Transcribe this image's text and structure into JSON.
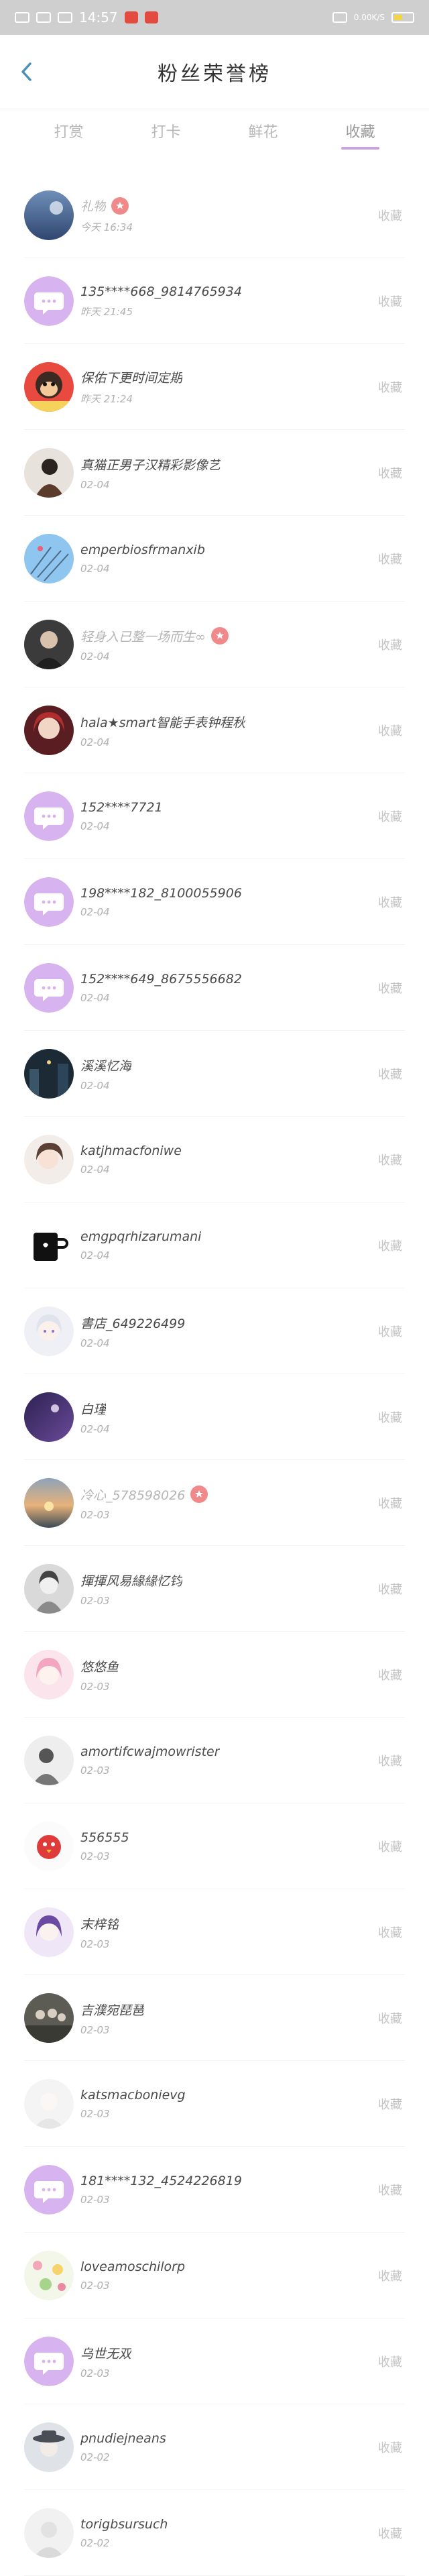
{
  "statusbar": {
    "clock": "14:57",
    "battery_text": "0.00K/S"
  },
  "header": {
    "title": "粉丝荣誉榜"
  },
  "tabs": [
    {
      "label": "打赏",
      "active": false
    },
    {
      "label": "打卡",
      "active": false
    },
    {
      "label": "鲜花",
      "active": false
    },
    {
      "label": "收藏",
      "active": true
    }
  ],
  "action_label": "收藏",
  "colors": {
    "accent": "#c9a3e0",
    "badge": "#f08a8a",
    "default_avatar": "#d7b4ef"
  },
  "fans": [
    {
      "name": "礼物",
      "time": "今天 16:34",
      "avatar": "dusk-sky",
      "badge": true,
      "faded": true
    },
    {
      "name": "135****668_9814765934",
      "time": "昨天 21:45",
      "avatar": "default-chat",
      "badge": false,
      "faded": false
    },
    {
      "name": "保佑下更时间定期",
      "time": "昨天 21:24",
      "avatar": "monkey",
      "badge": false,
      "faded": false
    },
    {
      "name": "真猫正男子汉精彩影像艺",
      "time": "02-04",
      "avatar": "figure-dark",
      "badge": false,
      "faded": false
    },
    {
      "name": "emperbiosfrmanxib",
      "time": "02-04",
      "avatar": "blue-sky",
      "badge": false,
      "faded": false
    },
    {
      "name": "轻身入已整一场而生∞",
      "time": "02-04",
      "avatar": "dark-portrait",
      "badge": true,
      "faded": true
    },
    {
      "name": "hala★smart智能手表钟程秋",
      "time": "02-04",
      "avatar": "red-hair",
      "badge": false,
      "faded": false
    },
    {
      "name": "152****7721",
      "time": "02-04",
      "avatar": "default-chat",
      "badge": false,
      "faded": false
    },
    {
      "name": "198****182_8100055906",
      "time": "02-04",
      "avatar": "default-chat",
      "badge": false,
      "faded": false
    },
    {
      "name": "152****649_8675556682",
      "time": "02-04",
      "avatar": "default-chat",
      "badge": false,
      "faded": false
    },
    {
      "name": "溪溪忆海",
      "time": "02-04",
      "avatar": "night-street",
      "badge": false,
      "faded": false
    },
    {
      "name": "katjhmacfoniwe",
      "time": "02-04",
      "avatar": "anime-girl",
      "badge": false,
      "faded": false
    },
    {
      "name": "emgpqrhizarumani",
      "time": "02-04",
      "avatar": "black-mug",
      "badge": false,
      "faded": false
    },
    {
      "name": "書店_649226499",
      "time": "02-04",
      "avatar": "white-anime",
      "badge": false,
      "faded": false
    },
    {
      "name": "白瑾",
      "time": "02-04",
      "avatar": "purple-night",
      "badge": false,
      "faded": false
    },
    {
      "name": "冷心_578598026",
      "time": "02-03",
      "avatar": "sunset",
      "badge": true,
      "faded": true
    },
    {
      "name": "揮揮风易緣緣忆钧",
      "time": "02-03",
      "avatar": "gray-girl",
      "badge": false,
      "faded": false
    },
    {
      "name": "悠悠鱼",
      "time": "02-03",
      "avatar": "pink-anime",
      "badge": false,
      "faded": false
    },
    {
      "name": "amortifcwajmowrister",
      "time": "02-03",
      "avatar": "bw-figure",
      "badge": false,
      "faded": false
    },
    {
      "name": "556555",
      "time": "02-03",
      "avatar": "red-bird",
      "badge": false,
      "faded": false
    },
    {
      "name": "末梓铭",
      "time": "02-03",
      "avatar": "purple-anime",
      "badge": false,
      "faded": false
    },
    {
      "name": "吉濮宛琵琶",
      "time": "02-03",
      "avatar": "group-dark",
      "badge": false,
      "faded": false
    },
    {
      "name": "katsmacbonievg",
      "time": "02-03",
      "avatar": "pale-girl",
      "badge": false,
      "faded": false
    },
    {
      "name": "181****132_4524226819",
      "time": "02-03",
      "avatar": "default-chat",
      "badge": false,
      "faded": false
    },
    {
      "name": "loveamoschilorp",
      "time": "02-03",
      "avatar": "floral",
      "badge": false,
      "faded": false
    },
    {
      "name": "乌世无双",
      "time": "02-03",
      "avatar": "default-chat",
      "badge": false,
      "faded": false
    },
    {
      "name": "pnudiejneans",
      "time": "02-02",
      "avatar": "hat-girl",
      "badge": false,
      "faded": false
    },
    {
      "name": "torigbsursuch",
      "time": "02-02",
      "avatar": "light-gray",
      "badge": false,
      "faded": false
    }
  ]
}
